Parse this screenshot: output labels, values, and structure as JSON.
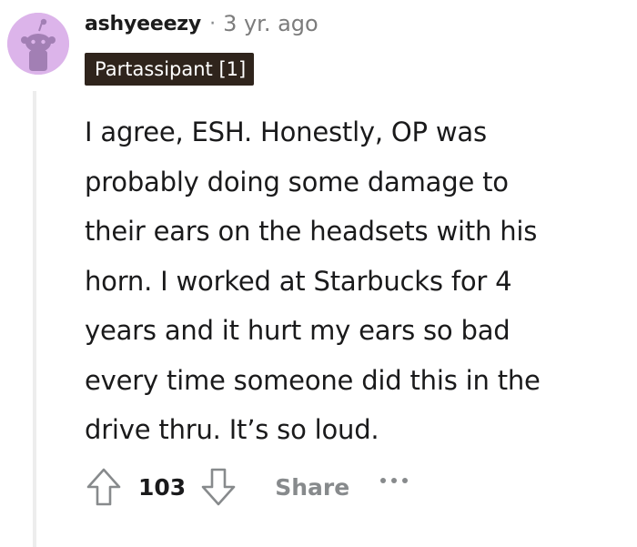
{
  "comment": {
    "author": "ashyeeezy",
    "separator": "·",
    "timestamp": "3 yr. ago",
    "flair": "Partassipant [1]",
    "body_lines": [
      "I agree, ESH. Honestly, OP was",
      "probably doing some damage to",
      "their ears on the headsets with his",
      "horn. I worked at Starbucks for 4",
      "years and it hurt my ears so bad",
      "every time someone did this in the",
      "drive thru. It’s so loud."
    ]
  },
  "actions": {
    "upvote_icon": "upvote-arrow-icon",
    "vote_count": "103",
    "downvote_icon": "downvote-arrow-icon",
    "share_label": "Share",
    "more_icon": "more-options-icon"
  },
  "colors": {
    "avatar_bg": "#dcb4ea",
    "flair_bg": "#2f241c",
    "muted_text": "#878a8c",
    "thread_line": "#ededed"
  }
}
